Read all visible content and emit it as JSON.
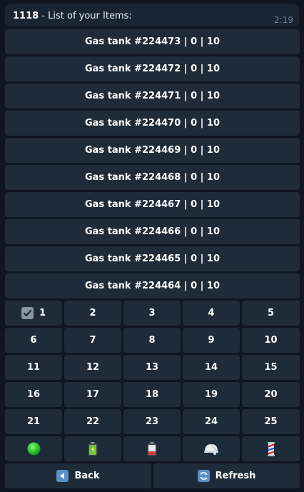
{
  "message": {
    "number": "1118",
    "text": " - List of your Items:",
    "time": "2:19"
  },
  "items": [
    "Gas tank #224473 | 0 | 10",
    "Gas tank #224472 | 0 | 10",
    "Gas tank #224471 | 0 | 10",
    "Gas tank #224470 | 0 | 10",
    "Gas tank #224469 | 0 | 10",
    "Gas tank #224468 | 0 | 10",
    "Gas tank #224467 | 0 | 10",
    "Gas tank #224466 | 0 | 10",
    "Gas tank #224465 | 0 | 10",
    "Gas tank #224464 | 0 | 10"
  ],
  "pages": [
    "1",
    "2",
    "3",
    "4",
    "5",
    "6",
    "7",
    "8",
    "9",
    "10",
    "11",
    "12",
    "13",
    "14",
    "15",
    "16",
    "17",
    "18",
    "19",
    "20",
    "21",
    "22",
    "23",
    "24",
    "25"
  ],
  "current_page": "1",
  "filters": [
    {
      "name": "green-circle-icon"
    },
    {
      "name": "battery-icon"
    },
    {
      "name": "low-battery-icon"
    },
    {
      "name": "helmet-icon"
    },
    {
      "name": "barber-pole-icon"
    }
  ],
  "nav": {
    "back_label": "Back",
    "refresh_label": "Refresh"
  },
  "colors": {
    "background": "#0e1621",
    "bubble": "#182533",
    "button": "#1e2c3a",
    "accent_blue": "#5b8fc7"
  }
}
